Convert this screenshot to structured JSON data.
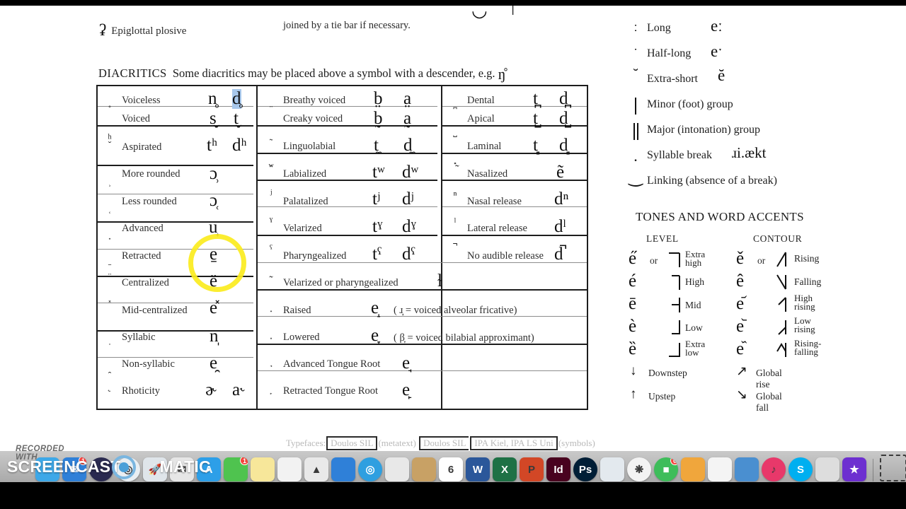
{
  "document": {
    "top_fragments": {
      "epiglottal_symbol": "ʡ",
      "epiglottal_label": "Epiglottal plosive",
      "tie_bar_text": "joined by a tie bar if necessary."
    },
    "diacritics_heading": {
      "keyword": "DIACRITICS",
      "text": "Some diacritics may be placed above a symbol with a descender, e.g.",
      "example": "ŋ̊"
    },
    "diacritics_table": {
      "col1": [
        {
          "mark": "̥",
          "label": "Voiceless",
          "ex1": "n̥",
          "ex2": "d̥"
        },
        {
          "mark": "̬",
          "label": "Voiced",
          "ex1": "s̬",
          "ex2": "t̬"
        },
        {
          "mark": "ʰ",
          "label": "Aspirated",
          "ex1": "tʰ",
          "ex2": "dʰ"
        },
        {
          "mark": "̹",
          "label": "More rounded",
          "ex1": "ɔ̹",
          "ex2": ""
        },
        {
          "mark": "̜",
          "label": "Less rounded",
          "ex1": "ɔ̜",
          "ex2": ""
        },
        {
          "mark": "̟",
          "label": "Advanced",
          "ex1": "u̟",
          "ex2": ""
        },
        {
          "mark": "̠",
          "label": "Retracted",
          "ex1": "e̠",
          "ex2": ""
        },
        {
          "mark": "̈",
          "label": "Centralized",
          "ex1": "ë",
          "ex2": ""
        },
        {
          "mark": "̽",
          "label": "Mid-centralized",
          "ex1": "e̽",
          "ex2": ""
        },
        {
          "mark": "̩",
          "label": "Syllabic",
          "ex1": "n̩",
          "ex2": ""
        },
        {
          "mark": "̯",
          "label": "Non-syllabic",
          "ex1": "e̯",
          "ex2": ""
        },
        {
          "mark": "˞",
          "label": "Rhoticity",
          "ex1": "ɚ",
          "ex2": "a˞"
        }
      ],
      "col2": [
        {
          "mark": "̤",
          "label": "Breathy voiced",
          "ex1": "b̤",
          "ex2": "a̤"
        },
        {
          "mark": "̰",
          "label": "Creaky voiced",
          "ex1": "b̰",
          "ex2": "a̰"
        },
        {
          "mark": "̼",
          "label": "Linguolabial",
          "ex1": "t̼",
          "ex2": "d̼"
        },
        {
          "mark": "ʷ",
          "label": "Labialized",
          "ex1": "tʷ",
          "ex2": "dʷ"
        },
        {
          "mark": "ʲ",
          "label": "Palatalized",
          "ex1": "tʲ",
          "ex2": "dʲ"
        },
        {
          "mark": "ˠ",
          "label": "Velarized",
          "ex1": "tˠ",
          "ex2": "dˠ"
        },
        {
          "mark": "ˤ",
          "label": "Pharyngealized",
          "ex1": "tˤ",
          "ex2": "dˤ"
        },
        {
          "mark": "̴",
          "label": "Velarized or pharyngealized",
          "ex1": "ɫ",
          "ex2": ""
        },
        {
          "mark": "̝",
          "label": "Raised",
          "ex1": "e̝",
          "ex2": "",
          "note": "( ɹ̝ = voiced alveolar fricative)"
        },
        {
          "mark": "̞",
          "label": "Lowered",
          "ex1": "e̞",
          "ex2": "",
          "note": "( β̞ = voiced bilabial approximant)"
        },
        {
          "mark": "̘",
          "label": "Advanced Tongue Root",
          "ex1": "e̘",
          "ex2": ""
        },
        {
          "mark": "̙",
          "label": "Retracted Tongue Root",
          "ex1": "e̙",
          "ex2": ""
        }
      ],
      "col3": [
        {
          "mark": "̪",
          "label": "Dental",
          "ex1": "t̪",
          "ex2": "d̪"
        },
        {
          "mark": "̺",
          "label": "Apical",
          "ex1": "t̺",
          "ex2": "d̺"
        },
        {
          "mark": "̻",
          "label": "Laminal",
          "ex1": "t̻",
          "ex2": "d̻"
        },
        {
          "mark": "̃",
          "label": "Nasalized",
          "ex1": "ẽ",
          "ex2": ""
        },
        {
          "mark": "ⁿ",
          "label": "Nasal release",
          "ex1": "dⁿ",
          "ex2": ""
        },
        {
          "mark": "ˡ",
          "label": "Lateral release",
          "ex1": "dˡ",
          "ex2": ""
        },
        {
          "mark": "̚",
          "label": "No audible release",
          "ex1": "d̚",
          "ex2": ""
        }
      ]
    },
    "suprasegmentals": [
      {
        "symbol": "ː",
        "label": "Long",
        "example": "eː"
      },
      {
        "symbol": "ˑ",
        "label": "Half-long",
        "example": "eˑ"
      },
      {
        "symbol": "̆",
        "label": "Extra-short",
        "example": "ĕ"
      },
      {
        "symbol": "|",
        "label": "Minor (foot) group",
        "example": ""
      },
      {
        "symbol": "‖",
        "label": "Major (intonation) group",
        "example": ""
      },
      {
        "symbol": ".",
        "label": "Syllable break",
        "example": "ɹi.ækt"
      },
      {
        "symbol": "‿",
        "label": "Linking (absence of a break)",
        "example": ""
      }
    ],
    "tones": {
      "heading": "TONES AND WORD ACCENTS",
      "level_heading": "LEVEL",
      "contour_heading": "CONTOUR",
      "or_text": "or",
      "level": [
        {
          "symbol": "e̋",
          "label": "Extra high",
          "label_l1": "Extra",
          "label_l2": "high"
        },
        {
          "symbol": "é",
          "label": "High",
          "label_l1": "High",
          "label_l2": ""
        },
        {
          "symbol": "ē",
          "label": "Mid",
          "label_l1": "Mid",
          "label_l2": ""
        },
        {
          "symbol": "è",
          "label": "Low",
          "label_l1": "Low",
          "label_l2": ""
        },
        {
          "symbol": "ȅ",
          "label": "Extra low",
          "label_l1": "Extra",
          "label_l2": "low"
        }
      ],
      "contour": [
        {
          "symbol": "ě",
          "label": "Rising",
          "label_l1": "Rising",
          "label_l2": ""
        },
        {
          "symbol": "ê",
          "label": "Falling",
          "label_l1": "Falling",
          "label_l2": ""
        },
        {
          "symbol": "e᷄",
          "label": "High rising",
          "label_l1": "High",
          "label_l2": "rising"
        },
        {
          "symbol": "e᷅",
          "label": "Low rising",
          "label_l1": "Low",
          "label_l2": "rising"
        },
        {
          "symbol": "e᷈",
          "label": "Rising-falling",
          "label_l1": "Rising-",
          "label_l2": "falling"
        }
      ],
      "extra_level": [
        {
          "icon": "↓",
          "label": "Downstep"
        },
        {
          "icon": "↑",
          "label": "Upstep"
        }
      ],
      "extra_contour": [
        {
          "icon": "↗",
          "label": "Global rise"
        },
        {
          "icon": "↘",
          "label": "Global fall"
        }
      ]
    },
    "typefaces": {
      "prefix": "Typefaces:",
      "font1": "Doulos SIL",
      "mid1": "(metatext)",
      "font2": "Doulos SIL",
      "font3": "IPA Kiel, IPA LS Uni",
      "suffix": "(symbols)"
    }
  },
  "annotations": {
    "highlight_circle_color": "#fbec1e",
    "selection_color": "#a8c8ec"
  },
  "watermark": {
    "recorded_with": "RECORDED WITH",
    "brand_left": "SCREENCAST",
    "brand_right": "MATIC"
  },
  "dock": {
    "items": [
      {
        "name": "finder",
        "glyph": "",
        "bg": "#3da8e8",
        "badge": ""
      },
      {
        "name": "mail",
        "glyph": "✉",
        "bg": "#2f80d8",
        "badge": "1"
      },
      {
        "name": "siri",
        "glyph": "",
        "bg": "#2a2a50",
        "badge": ""
      },
      {
        "name": "safari",
        "glyph": "◎",
        "bg": "#e9eef2",
        "badge": ""
      },
      {
        "name": "launchpad",
        "glyph": "🚀",
        "bg": "#dfe5ea",
        "badge": ""
      },
      {
        "name": "sparrow-mail",
        "glyph": "✉",
        "bg": "#e6e6e6",
        "badge": ""
      },
      {
        "name": "app-store",
        "glyph": "A",
        "bg": "#2d9fe8",
        "badge": ""
      },
      {
        "name": "messages",
        "glyph": "",
        "bg": "#4fc34f",
        "badge": "1"
      },
      {
        "name": "notes",
        "glyph": "",
        "bg": "#f7e79a",
        "badge": ""
      },
      {
        "name": "contacts",
        "glyph": "",
        "bg": "#f2f2f2",
        "badge": ""
      },
      {
        "name": "drive",
        "glyph": "▲",
        "bg": "#e9e9e9",
        "badge": ""
      },
      {
        "name": "chrome-alt",
        "glyph": "",
        "bg": "#2f80d8",
        "badge": ""
      },
      {
        "name": "safari-2",
        "glyph": "◎",
        "bg": "#2f9fe0",
        "badge": ""
      },
      {
        "name": "chrome",
        "glyph": "",
        "bg": "#e8e8e8",
        "badge": ""
      },
      {
        "name": "folder",
        "glyph": "",
        "bg": "#c8a165",
        "badge": ""
      },
      {
        "name": "calendar",
        "glyph": "6",
        "bg": "#ffffff",
        "badge": ""
      },
      {
        "name": "word",
        "glyph": "W",
        "bg": "#2b579a",
        "badge": ""
      },
      {
        "name": "excel",
        "glyph": "X",
        "bg": "#1e7145",
        "badge": ""
      },
      {
        "name": "powerpoint",
        "glyph": "P",
        "bg": "#d24726",
        "badge": ""
      },
      {
        "name": "indesign",
        "glyph": "Id",
        "bg": "#49021f",
        "badge": ""
      },
      {
        "name": "photoshop",
        "glyph": "Ps",
        "bg": "#001e36",
        "badge": ""
      },
      {
        "name": "preview",
        "glyph": "",
        "bg": "#e3e9ee",
        "badge": ""
      },
      {
        "name": "photos",
        "glyph": "❋",
        "bg": "#f3f3f3",
        "badge": ""
      },
      {
        "name": "facetime",
        "glyph": "■",
        "bg": "#3ebd5a",
        "badge": "0"
      },
      {
        "name": "keynote",
        "glyph": "",
        "bg": "#f0a63c",
        "badge": ""
      },
      {
        "name": "numbers",
        "glyph": "",
        "bg": "#f4f4f4",
        "badge": ""
      },
      {
        "name": "screenflow",
        "glyph": "",
        "bg": "#4a8fd0",
        "badge": ""
      },
      {
        "name": "itunes",
        "glyph": "♪",
        "bg": "#e8386a",
        "badge": ""
      },
      {
        "name": "skype",
        "glyph": "S",
        "bg": "#00aff0",
        "badge": ""
      },
      {
        "name": "screencast",
        "glyph": "",
        "bg": "#dddddd",
        "badge": ""
      },
      {
        "name": "imovie",
        "glyph": "★",
        "bg": "#6d2fd0",
        "badge": ""
      },
      {
        "name": "downloads-stack",
        "glyph": "",
        "bg": "transparent",
        "badge": ""
      },
      {
        "name": "window-1",
        "glyph": "",
        "bg": "#cfe0ea",
        "badge": ""
      },
      {
        "name": "window-2",
        "glyph": "",
        "bg": "#151515",
        "badge": ""
      },
      {
        "name": "window-3",
        "glyph": "",
        "bg": "#f4f4f4",
        "badge": ""
      },
      {
        "name": "window-4",
        "glyph": "",
        "bg": "#ededed",
        "badge": ""
      },
      {
        "name": "window-5",
        "glyph": "",
        "bg": "#e7e7e7",
        "badge": ""
      }
    ]
  }
}
